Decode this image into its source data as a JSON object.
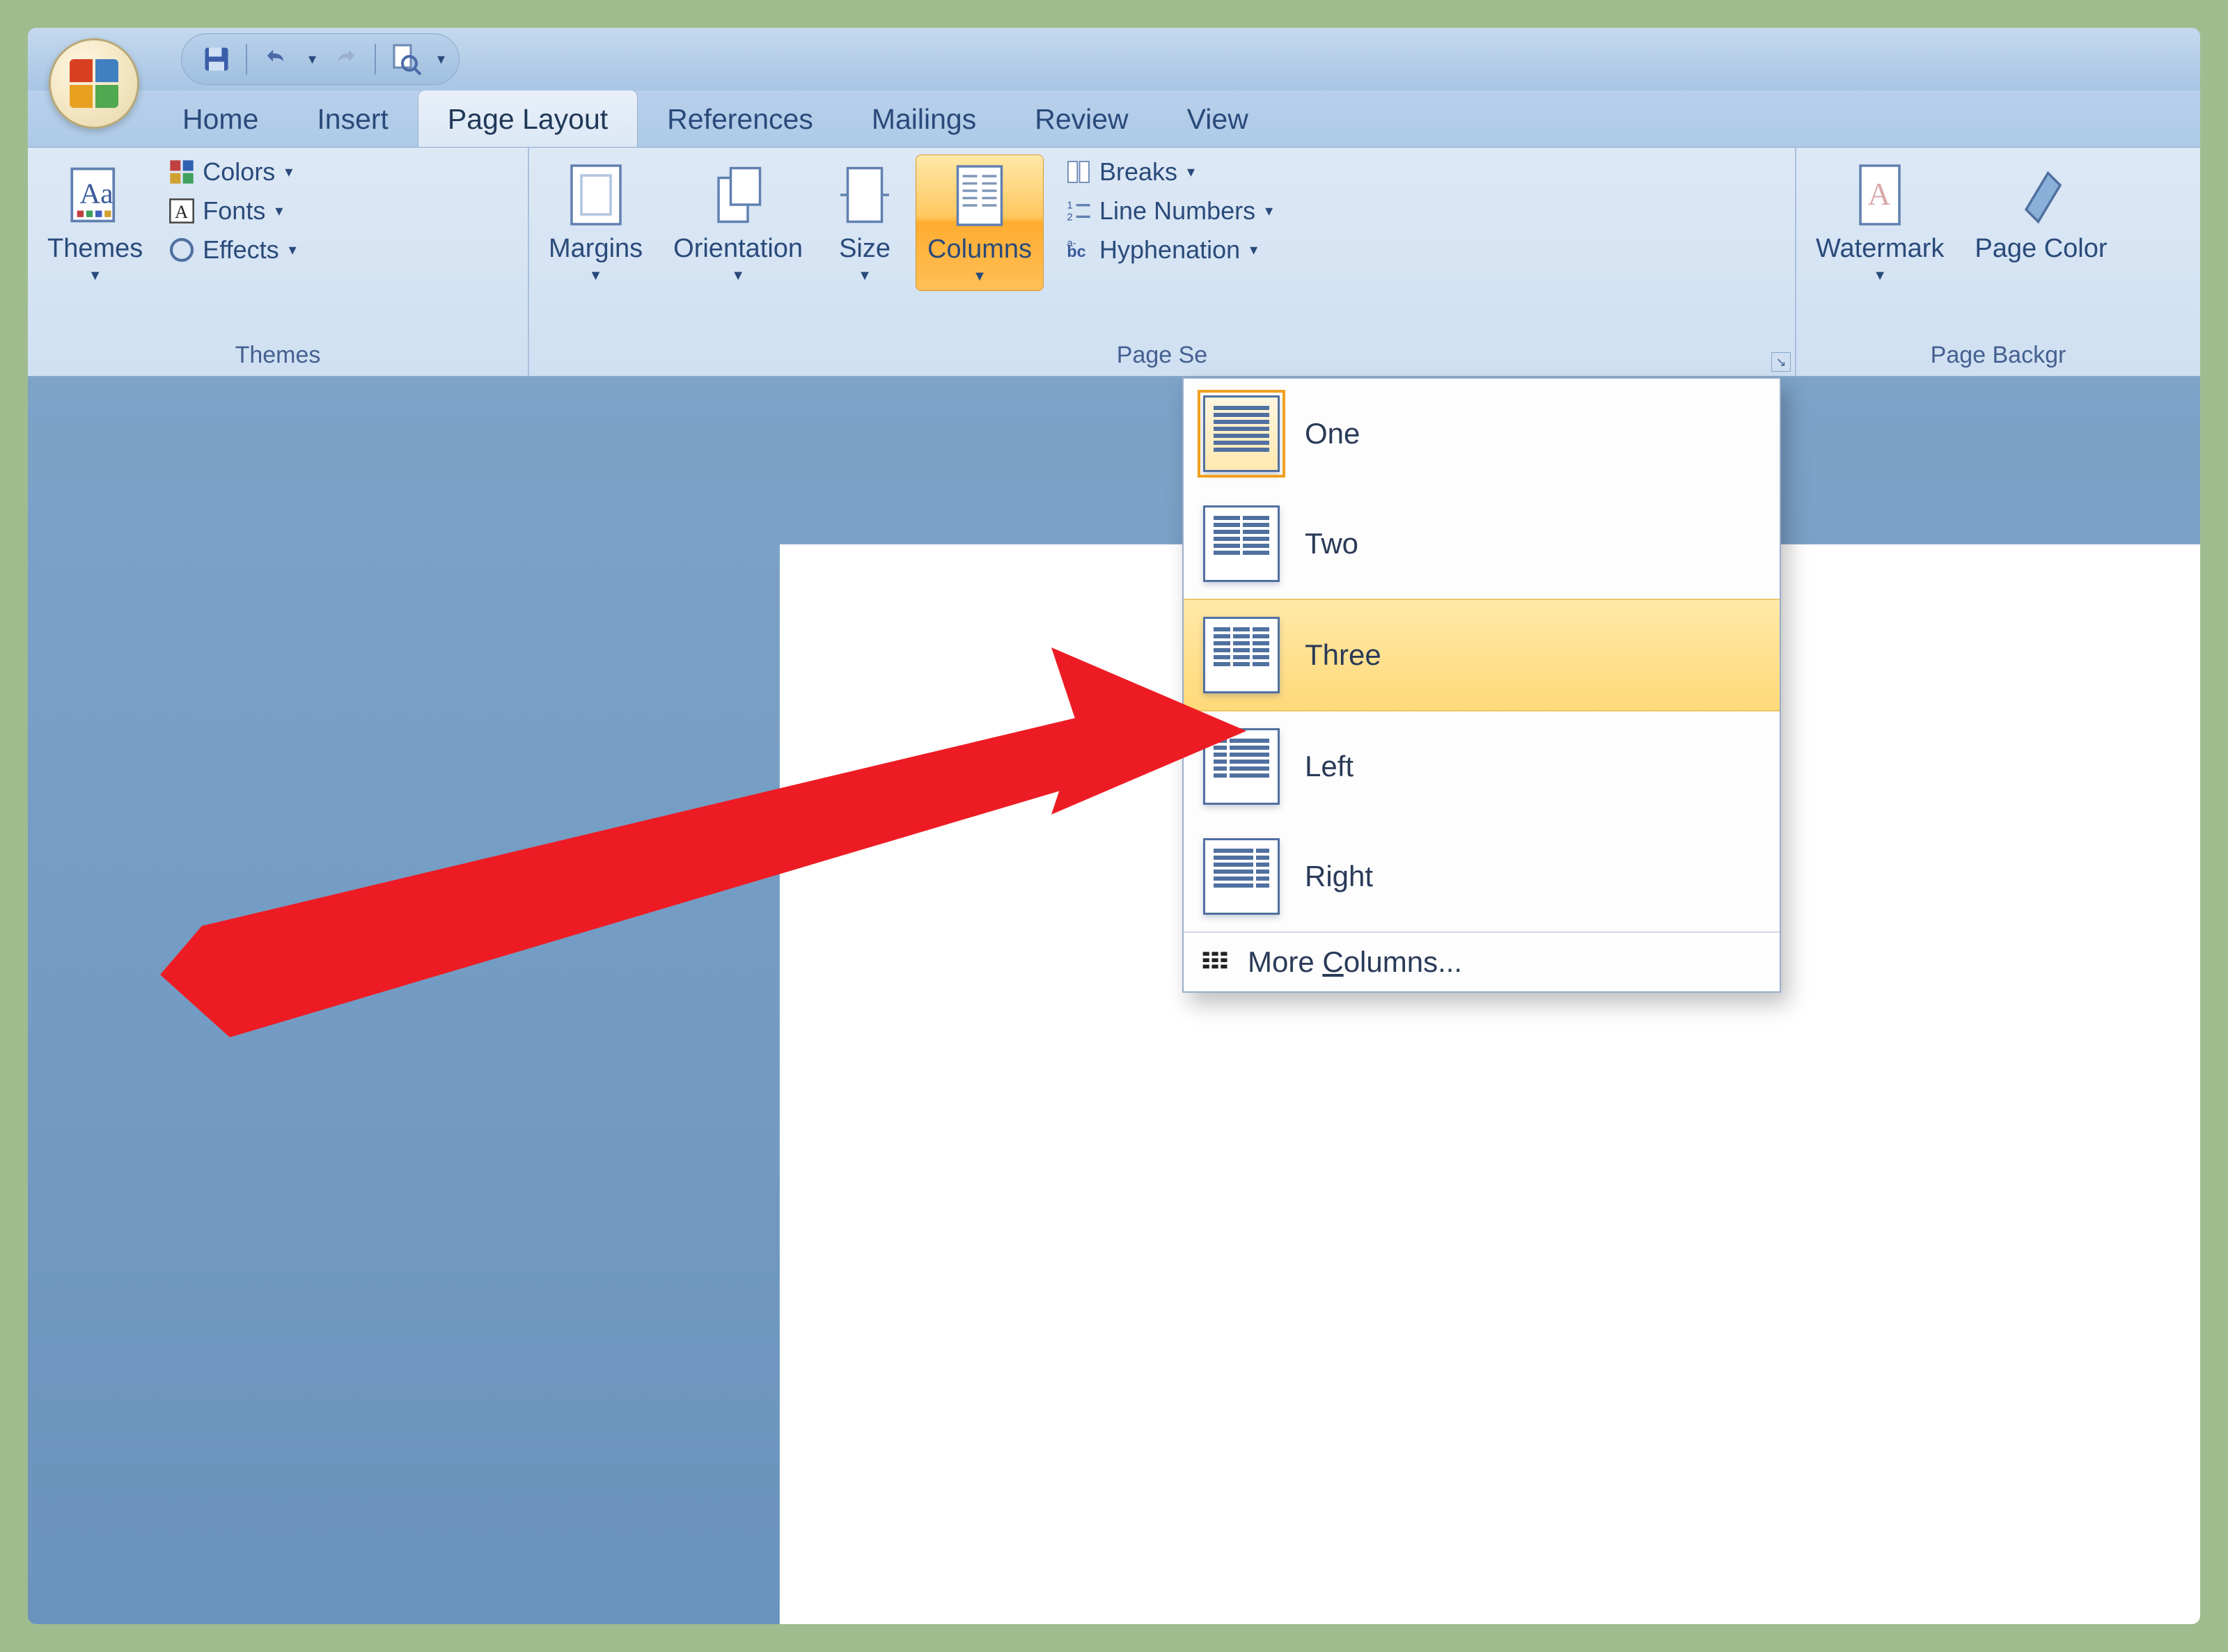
{
  "tabs": {
    "home": "Home",
    "insert": "Insert",
    "page_layout": "Page Layout",
    "references": "References",
    "mailings": "Mailings",
    "review": "Review",
    "view": "View"
  },
  "groups": {
    "themes": {
      "label": "Themes",
      "themes_btn": "Themes",
      "colors": "Colors",
      "fonts": "Fonts",
      "effects": "Effects"
    },
    "page_setup": {
      "label": "Page Setup",
      "label_cropped": "Page Se",
      "margins": "Margins",
      "orientation": "Orientation",
      "size": "Size",
      "columns": "Columns",
      "breaks": "Breaks",
      "line_numbers": "Line Numbers",
      "hyphenation": "Hyphenation"
    },
    "page_bg": {
      "label_cropped": "Page Backgr",
      "watermark": "Watermark",
      "page_color_cropped": "Page Color"
    }
  },
  "columns_menu": {
    "one": "One",
    "two": "Two",
    "three": "Three",
    "left": "Left",
    "right": "Right",
    "more": "More Columns...",
    "more_prefix": "More ",
    "more_u": "C",
    "more_suffix": "olumns..."
  },
  "colors": {
    "accent": "#2a4a7a",
    "highlight_bg_top": "#ffe9a8",
    "highlight_bg_bot": "#ffd978",
    "arrow": "#ed1c24"
  }
}
